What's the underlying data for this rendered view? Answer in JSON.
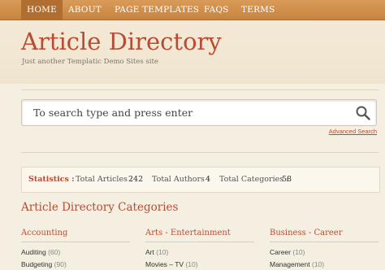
{
  "nav": {
    "items": [
      "HOME",
      "ABOUT",
      "PAGE TEMPLATES",
      "FAQS",
      "TERMS"
    ]
  },
  "site": {
    "title": "Article Directory",
    "tagline": "Just another Templatic Demo Sites site"
  },
  "search": {
    "placeholder": "To search type and press enter",
    "advanced_label": "Advanced Search"
  },
  "stats": {
    "label": "Statistics :",
    "articles_label": "Total Articles :",
    "articles": "242",
    "authors_label": "Total Authors :",
    "authors": "4",
    "categories_label": "Total Categories :",
    "categories": "58"
  },
  "categories": {
    "heading": "Article Directory Categories",
    "columns": [
      {
        "title": "Accounting",
        "items": [
          {
            "name": "Auditing",
            "count": "(60)"
          },
          {
            "name": "Budgeting",
            "count": "(90)"
          }
        ]
      },
      {
        "title": "Arts - Entertainment",
        "items": [
          {
            "name": "Art",
            "count": "(10)"
          },
          {
            "name": "Movies – TV",
            "count": "(10)"
          }
        ]
      },
      {
        "title": "Business - Career",
        "items": [
          {
            "name": "Career",
            "count": "(10)"
          },
          {
            "name": "Management",
            "count": "(10)"
          }
        ]
      }
    ]
  },
  "colors": {
    "accent": "#b84b33",
    "nav_bg": "#d18f4c",
    "page_bg": "#f5efe1"
  }
}
